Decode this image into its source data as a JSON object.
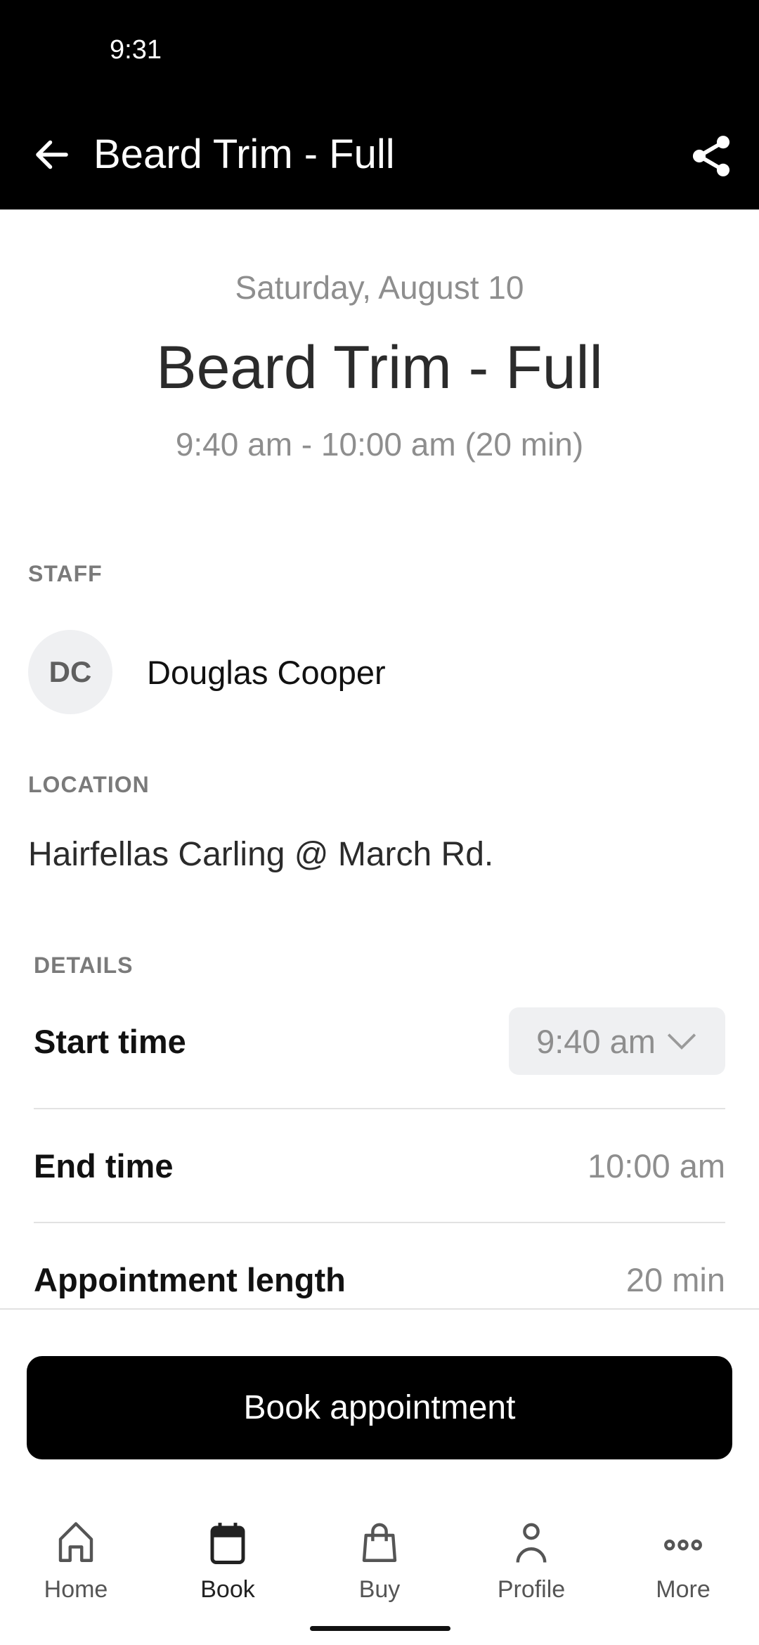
{
  "status_bar": {
    "time": "9:31"
  },
  "header": {
    "title": "Beard Trim - Full",
    "back_icon": "arrow-left-icon",
    "share_icon": "share-icon"
  },
  "summary": {
    "date": "Saturday, August 10",
    "service": "Beard Trim - Full",
    "time_range": "9:40 am - 10:00 am (20 min)"
  },
  "staff": {
    "label": "STAFF",
    "initials": "DC",
    "name": "Douglas Cooper"
  },
  "location": {
    "label": "LOCATION",
    "address": "Hairfellas Carling @ March Rd."
  },
  "details": {
    "label": "DETAILS",
    "start_time": {
      "label": "Start time",
      "value": "9:40 am"
    },
    "end_time": {
      "label": "End time",
      "value": "10:00 am"
    },
    "length": {
      "label": "Appointment length",
      "value": "20 min"
    }
  },
  "actions": {
    "book_label": "Book appointment"
  },
  "nav": {
    "items": [
      {
        "label": "Home",
        "icon": "home-icon",
        "active": false
      },
      {
        "label": "Book",
        "icon": "calendar-icon",
        "active": true
      },
      {
        "label": "Buy",
        "icon": "shopping-bag-icon",
        "active": false
      },
      {
        "label": "Profile",
        "icon": "person-icon",
        "active": false
      },
      {
        "label": "More",
        "icon": "more-dots-icon",
        "active": false
      }
    ]
  },
  "colors": {
    "header_bg": "#000000",
    "primary_button": "#000000",
    "muted_text": "#8e8e8e",
    "chip_bg": "#eff0f2"
  }
}
